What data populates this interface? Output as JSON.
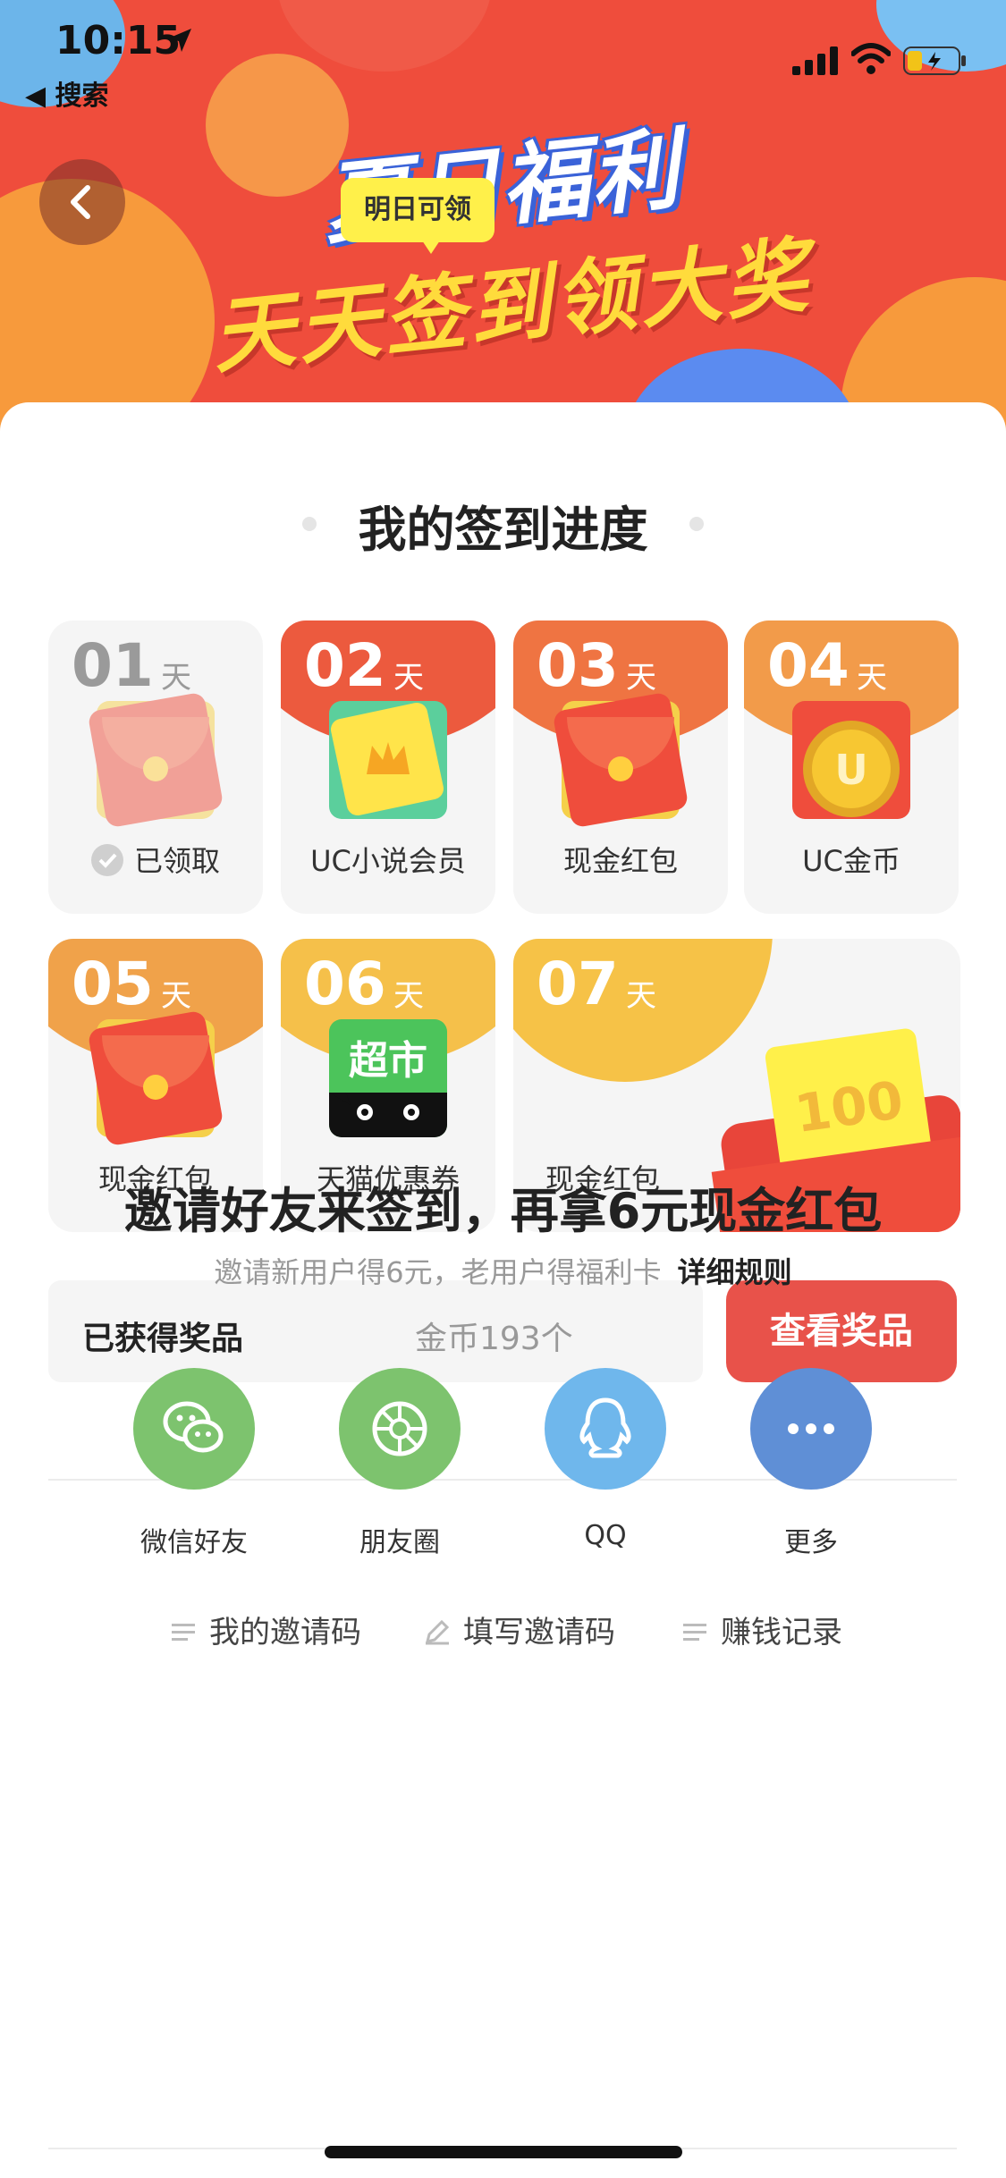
{
  "status_bar": {
    "time": "10:15",
    "back_app": "◀ 搜索"
  },
  "banner": {
    "title_line1": "夏日福利",
    "title_line2": "天天签到领大奖"
  },
  "progress": {
    "title": "我的签到进度",
    "tomorrow_badge": "明日可领",
    "day_unit": "天",
    "days": [
      {
        "num": "01",
        "label": "已领取",
        "reward": "red-envelope",
        "claimed": true
      },
      {
        "num": "02",
        "label": "UC小说会员",
        "reward": "novel-membership"
      },
      {
        "num": "03",
        "label": "现金红包",
        "reward": "red-envelope"
      },
      {
        "num": "04",
        "label": "UC金币",
        "reward": "gold-coin"
      },
      {
        "num": "05",
        "label": "现金红包",
        "reward": "red-envelope"
      },
      {
        "num": "06",
        "label": "天猫优惠券",
        "reward": "tmall-supermarket",
        "icon_text": "超市"
      },
      {
        "num": "07",
        "label": "现金红包",
        "reward": "big-red-envelope",
        "icon_text": "100"
      }
    ]
  },
  "prizes": {
    "label": "已获得奖品",
    "value": "金币193个",
    "button": "查看奖品"
  },
  "invite": {
    "title": "邀请好友来签到，再拿6元现金红包",
    "subtitle": "邀请新用户得6元，老用户得福利卡",
    "rules_link": "详细规则",
    "share_targets": [
      {
        "label": "微信好友",
        "icon": "wechat-icon",
        "color": "#7dc36e"
      },
      {
        "label": "朋友圈",
        "icon": "moments-icon",
        "color": "#7dc36e"
      },
      {
        "label": "QQ",
        "icon": "qq-icon",
        "color": "#6fb7ec"
      },
      {
        "label": "更多",
        "icon": "more-icon",
        "color": "#5f8fd6"
      }
    ],
    "links": [
      {
        "label": "我的邀请码",
        "icon": "list-icon"
      },
      {
        "label": "填写邀请码",
        "icon": "pencil-icon"
      },
      {
        "label": "赚钱记录",
        "icon": "list-icon"
      }
    ]
  },
  "colors": {
    "accent": "#e8524a",
    "banner": "#ef4d3c",
    "gold": "#f2b93a"
  }
}
